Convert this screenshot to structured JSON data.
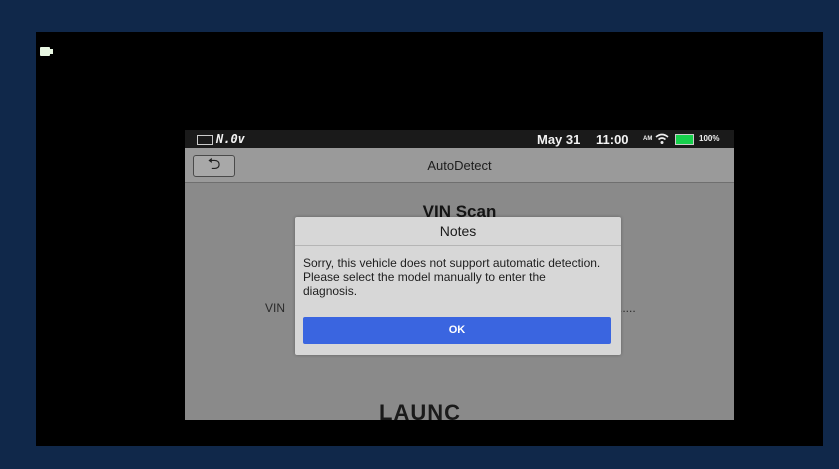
{
  "status_bar": {
    "voltage": "N.0v",
    "date": "May 31",
    "time": "11:00",
    "ampm": "AM",
    "battery_percent": "100%",
    "battery_color": "#17d04c",
    "icons": [
      "battery-icon",
      "wifi-icon",
      "battery-level-icon"
    ]
  },
  "title_bar": {
    "title": "AutoDetect",
    "back_icon": "back-arrow-icon"
  },
  "content": {
    "heading": "VIN Scan",
    "vin_label": "VIN",
    "scanning_text": "n......"
  },
  "dialog": {
    "title": "Notes",
    "message": "Sorry, this vehicle does not support automatic detection. Please select the model manually to enter the diagnosis.",
    "ok_label": "OK",
    "ok_color": "#3a65e0"
  },
  "device": {
    "brand": "LAUNC"
  }
}
